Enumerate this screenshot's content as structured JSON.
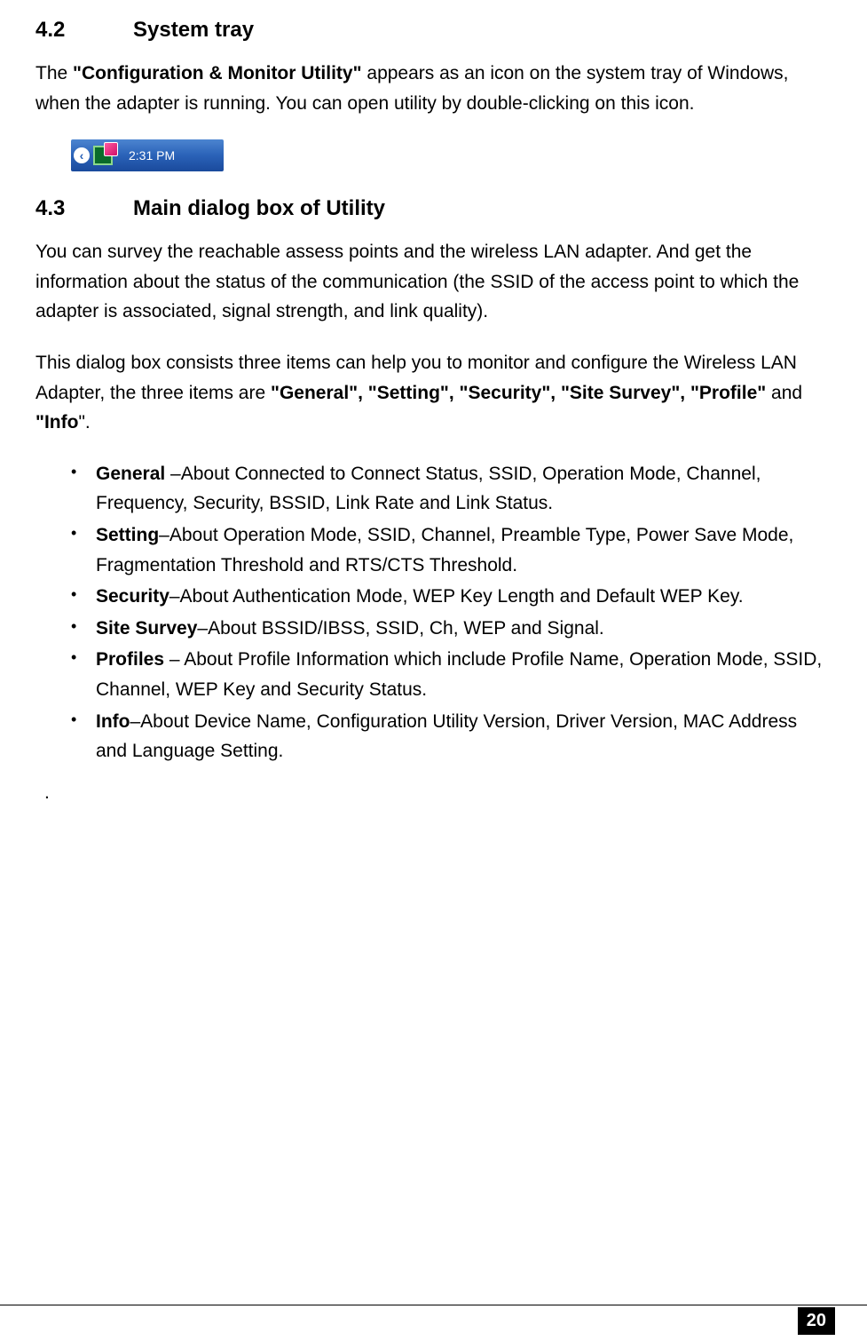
{
  "section1": {
    "num": "4.2",
    "title": "System tray"
  },
  "para1": {
    "prefix": "The ",
    "bold": "\"Configuration & Monitor Utility\"",
    "suffix": " appears as an icon on the system tray of Windows, when the adapter is running. You can open utility by double-clicking on this icon."
  },
  "systray": {
    "time": "2:31 PM"
  },
  "section2": {
    "num": "4.3",
    "title": "Main dialog box of Utility"
  },
  "para2": "You can survey the reachable assess points and the wireless LAN adapter. And get the information about the status of the communication (the SSID of the access point to which the adapter is associated, signal strength, and link quality).",
  "para3": {
    "prefix": "This dialog box consists three items can help you to monitor and configure the Wireless LAN Adapter, the three items are ",
    "bold1": "\"General\", \"Setting\", \"Security\", \"Site Survey\", \"Profile\"",
    "mid": " and ",
    "bold2": "\"Info",
    "suffix": "\"."
  },
  "bullets": [
    {
      "bold": "General ",
      "text": "–About Connected to Connect Status, SSID, Operation Mode, Channel, Frequency, Security, BSSID, Link Rate and Link Status."
    },
    {
      "bold": "Setting",
      "text": "–About Operation Mode, SSID, Channel, Preamble Type, Power Save Mode, Fragmentation Threshold and RTS/CTS Threshold."
    },
    {
      "bold": "Security",
      "text": "–About Authentication Mode, WEP Key Length and Default WEP Key."
    },
    {
      "bold": "Site Survey",
      "text": "–About BSSID/IBSS, SSID, Ch, WEP and Signal."
    },
    {
      "bold": "Profiles",
      "text": " – About Profile Information which include Profile Name, Operation Mode, SSID, Channel, WEP Key and Security Status."
    },
    {
      "bold": "Info",
      "text": "–About Device Name, Configuration Utility Version, Driver Version, MAC Address and Language Setting."
    }
  ],
  "afterdot": ".",
  "pagenum": "20"
}
